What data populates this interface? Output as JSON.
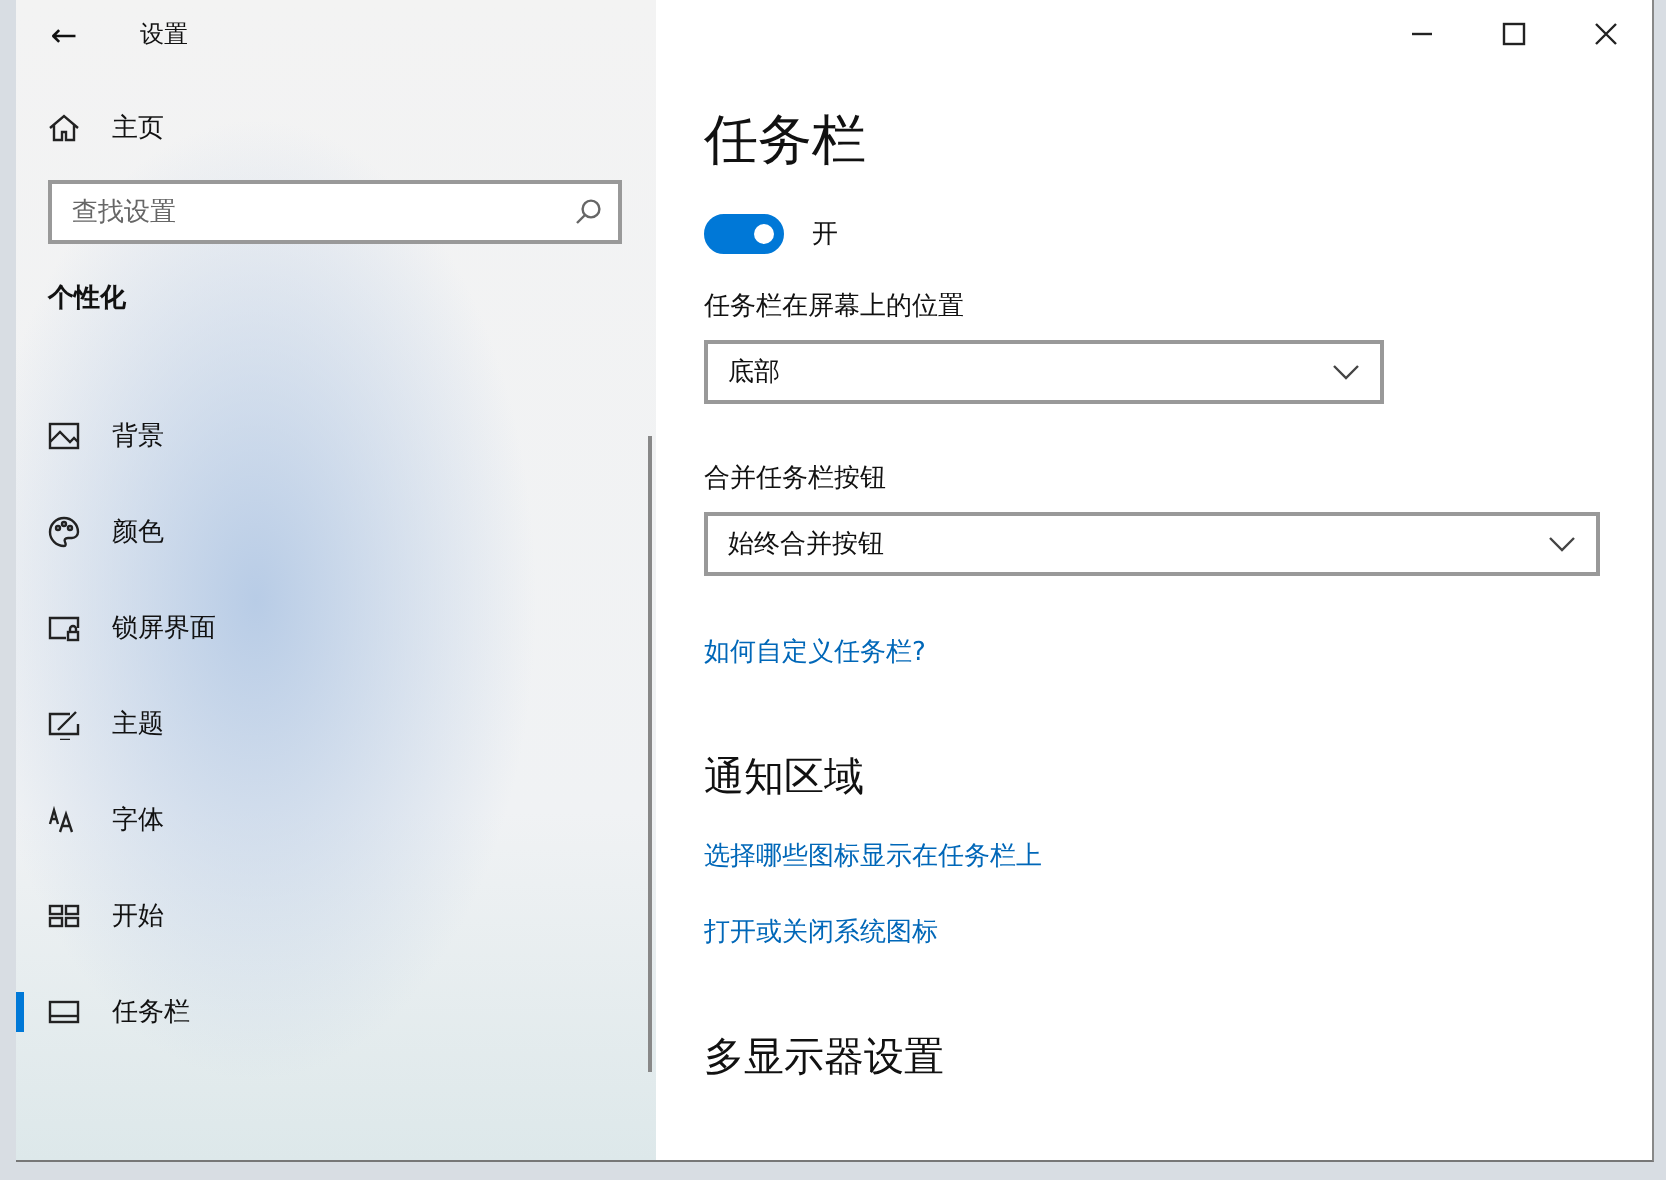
{
  "window": {
    "title": "设置",
    "back": "←"
  },
  "sidebar": {
    "home": "主页",
    "search": {
      "placeholder": "查找设置"
    },
    "section": "个性化",
    "items": [
      {
        "label": "背景",
        "selected": false
      },
      {
        "label": "颜色",
        "selected": false
      },
      {
        "label": "锁屏界面",
        "selected": false
      },
      {
        "label": "主题",
        "selected": false
      },
      {
        "label": "字体",
        "selected": false
      },
      {
        "label": "开始",
        "selected": false
      },
      {
        "label": "任务栏",
        "selected": true
      }
    ]
  },
  "page": {
    "title": "任务栏",
    "items": [
      {
        "kind": "toggle",
        "on": true,
        "label": "开"
      },
      {
        "kind": "dropdown",
        "label": "任务栏在屏幕上的位置",
        "value": "底部"
      },
      {
        "kind": "dropdown",
        "label": "合并任务栏按钮",
        "value": "始终合并按钮"
      },
      {
        "kind": "link",
        "label": "如何自定义任务栏?"
      },
      {
        "kind": "heading",
        "label": "通知区域"
      },
      {
        "kind": "link",
        "label": "选择哪些图标显示在任务栏上"
      },
      {
        "kind": "link",
        "label": "打开或关闭系统图标"
      },
      {
        "kind": "heading",
        "label": "多显示器设置"
      }
    ]
  }
}
